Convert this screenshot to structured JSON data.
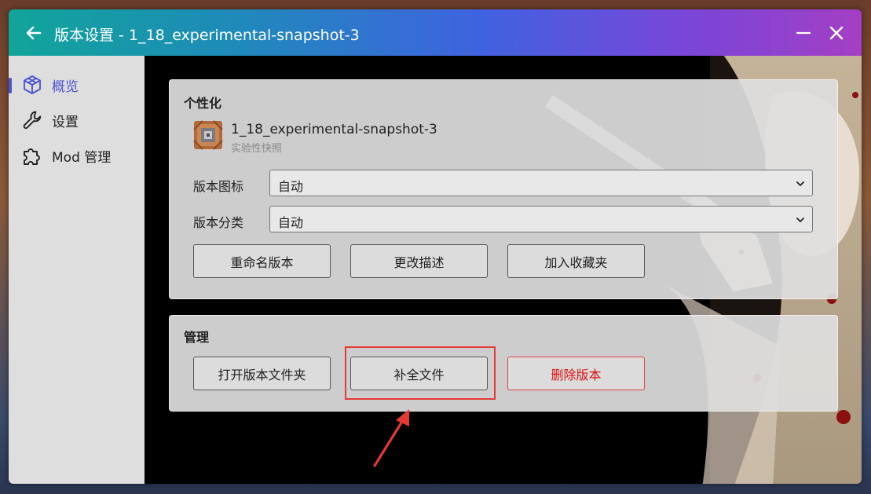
{
  "window": {
    "title": "版本设置 - 1_18_experimental-snapshot-3"
  },
  "sidebar": {
    "items": [
      {
        "label": "概览",
        "icon": "cube-icon",
        "active": true
      },
      {
        "label": "设置",
        "icon": "wrench-icon",
        "active": false
      },
      {
        "label": "Mod 管理",
        "icon": "puzzle-icon",
        "active": false
      }
    ]
  },
  "personalize": {
    "title": "个性化",
    "version_name": "1_18_experimental-snapshot-3",
    "version_type": "实验性快照",
    "icon_label": "版本图标",
    "icon_value": "自动",
    "category_label": "版本分类",
    "category_value": "自动",
    "buttons": {
      "rename": "重命名版本",
      "description": "更改描述",
      "favorite": "加入收藏夹"
    }
  },
  "manage": {
    "title": "管理",
    "buttons": {
      "open_folder": "打开版本文件夹",
      "complete_files": "补全文件",
      "delete": "删除版本"
    }
  },
  "colors": {
    "accent": "#4a55d6",
    "danger": "#dd1111",
    "highlight": "#e53935"
  }
}
